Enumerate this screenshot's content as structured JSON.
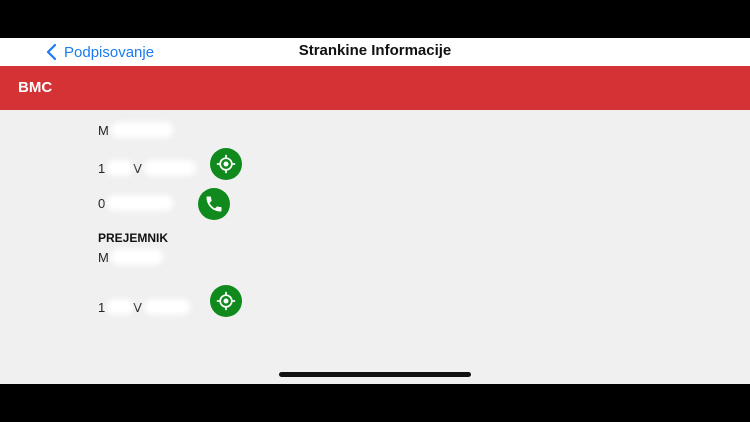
{
  "nav": {
    "back_label": "Podpisovanje",
    "title": "Strankine Informacije"
  },
  "banner": {
    "title": "BMC"
  },
  "sender": {
    "name_initial": "M",
    "address_prefix": "1",
    "address_letter": "V",
    "phone_prefix": "0"
  },
  "recipient": {
    "label": "PREJEMNIK",
    "name_initial": "M",
    "address_prefix": "1",
    "address_letter": "V"
  },
  "colors": {
    "accent_blue": "#1a7cf0",
    "banner_red": "#d53235",
    "action_green": "#108a1c"
  },
  "icons": [
    "chevron-left-icon",
    "location-target-icon",
    "phone-icon"
  ]
}
